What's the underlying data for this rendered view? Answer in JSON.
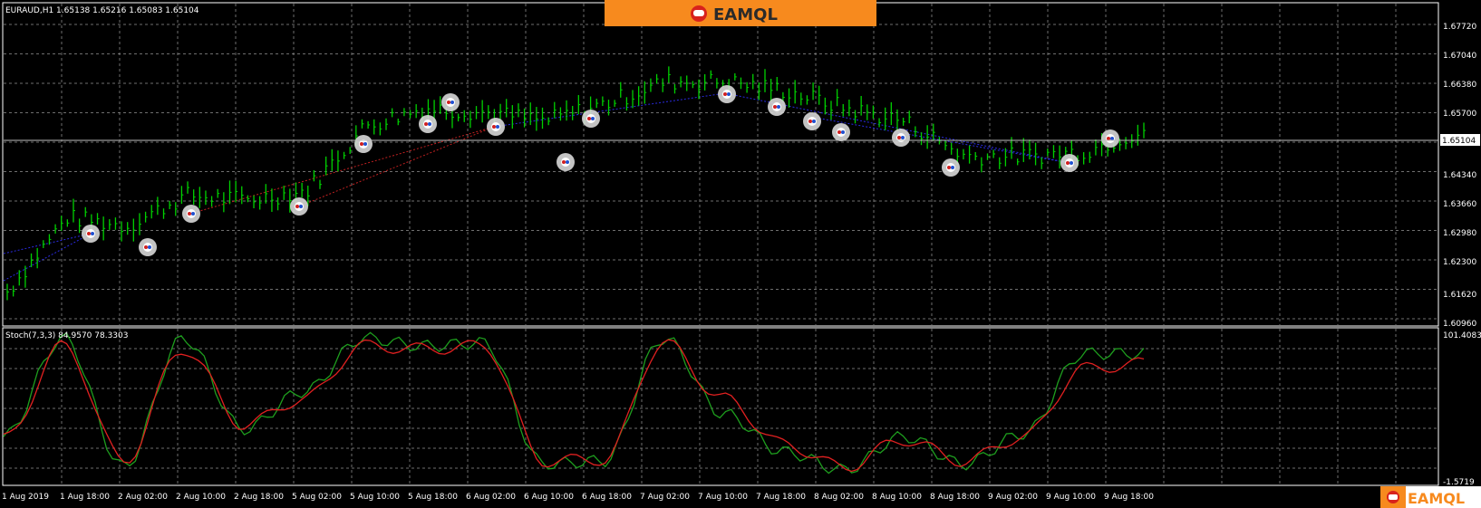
{
  "main_chart": {
    "header": "EURAUD,H1  1.65138 1.65216 1.65083 1.65104",
    "current_price": "1.65104",
    "price_ticks": [
      "1.67720",
      "1.67040",
      "1.66380",
      "1.65700",
      "1.65104",
      "1.64340",
      "1.63660",
      "1.62980",
      "1.62300",
      "1.61620",
      "1.60960"
    ]
  },
  "sub_chart": {
    "header": "Stoch(7,3,3) 84.9570 78.3303",
    "top_tick": "101.4083",
    "bottom_tick": "-1.5719"
  },
  "time_axis": [
    "1 Aug 2019",
    "1 Aug 18:00",
    "2 Aug 02:00",
    "2 Aug 10:00",
    "2 Aug 18:00",
    "5 Aug 02:00",
    "5 Aug 10:00",
    "5 Aug 18:00",
    "6 Aug 02:00",
    "6 Aug 10:00",
    "6 Aug 18:00",
    "7 Aug 02:00",
    "7 Aug 10:00",
    "7 Aug 18:00",
    "8 Aug 02:00",
    "8 Aug 10:00",
    "8 Aug 18:00",
    "9 Aug 02:00",
    "9 Aug 10:00",
    "9 Aug 18:00"
  ],
  "branding": {
    "top_logo": "EAMQL",
    "bottom_logo": "EAMQL"
  },
  "colors": {
    "background": "#000000",
    "grid": "#8a8a8a",
    "candles": "#00d000",
    "stoch_main": "#1e9e1e",
    "stoch_signal": "#e02020",
    "trend_blue": "#2a2ae0",
    "trend_red": "#c02020",
    "brand_orange": "#f78a1e",
    "price_line": "#c0c0c0"
  },
  "chart_data": [
    {
      "type": "line",
      "title": "EURAUD,H1",
      "symbol": "EURAUD",
      "timeframe": "H1",
      "ohlc_last": {
        "open": 1.65138,
        "high": 1.65216,
        "low": 1.65083,
        "close": 1.65104
      },
      "ylim": [
        1.6064,
        1.6798
      ],
      "x": [
        "1 Aug 2019",
        "1 Aug 18:00",
        "2 Aug 02:00",
        "2 Aug 10:00",
        "2 Aug 18:00",
        "5 Aug 02:00",
        "5 Aug 10:00",
        "5 Aug 18:00",
        "6 Aug 02:00",
        "6 Aug 10:00",
        "6 Aug 18:00",
        "7 Aug 02:00",
        "7 Aug 10:00",
        "7 Aug 18:00",
        "8 Aug 02:00",
        "8 Aug 10:00",
        "8 Aug 18:00",
        "9 Aug 02:00",
        "9 Aug 10:00",
        "9 Aug 18:00"
      ],
      "series": [
        {
          "values": [
            1.614,
            1.631,
            1.629,
            1.636,
            1.635,
            1.637,
            1.652,
            1.656,
            1.655,
            1.653,
            1.657,
            1.662,
            1.662,
            1.66,
            1.656,
            1.653,
            1.645,
            1.645,
            1.646,
            1.651
          ]
        }
      ],
      "grid": true
    },
    {
      "type": "line",
      "title": "Stoch(7,3,3) 84.9570 78.3303",
      "ylim": [
        -1.5719,
        101.4083
      ],
      "x": [
        "1 Aug 2019",
        "1 Aug 18:00",
        "2 Aug 02:00",
        "2 Aug 10:00",
        "2 Aug 18:00",
        "5 Aug 02:00",
        "5 Aug 10:00",
        "5 Aug 18:00",
        "6 Aug 02:00",
        "6 Aug 10:00",
        "6 Aug 18:00",
        "7 Aug 02:00",
        "7 Aug 10:00",
        "7 Aug 18:00",
        "8 Aug 02:00",
        "8 Aug 10:00",
        "8 Aug 18:00",
        "9 Aug 02:00",
        "9 Aug 10:00",
        "9 Aug 18:00"
      ],
      "series": [
        {
          "values": [
            30,
            95,
            10,
            95,
            35,
            60,
            95,
            90,
            92,
            12,
            14,
            95,
            45,
            20,
            8,
            30,
            12,
            32,
            85,
            84.957
          ]
        },
        {
          "values": [
            28,
            90,
            14,
            88,
            38,
            55,
            90,
            88,
            90,
            14,
            15,
            92,
            55,
            25,
            10,
            28,
            14,
            30,
            75,
            78.3303
          ]
        }
      ],
      "grid": true
    }
  ]
}
